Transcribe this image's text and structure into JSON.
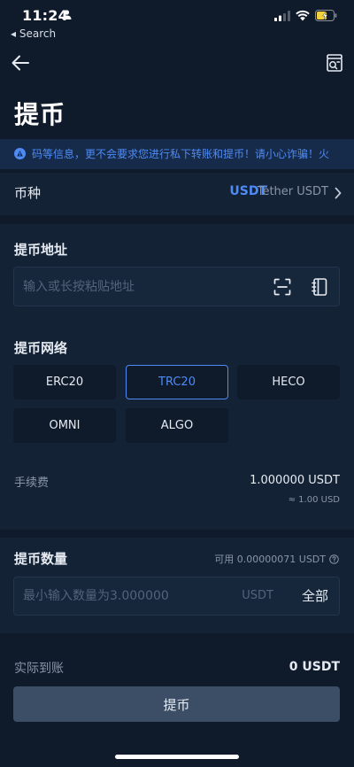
{
  "status_bar": {
    "time": "11:24",
    "back_label": "◂ Search"
  },
  "header": {
    "title": "提币"
  },
  "notice": {
    "text": "码等信息，更不会要求您进行私下转账和提币！请小心诈骗！火"
  },
  "coin": {
    "label": "币种",
    "symbol": "USDT",
    "name": "Tether USDT"
  },
  "address": {
    "label": "提币地址",
    "placeholder": "输入或长按粘贴地址"
  },
  "network": {
    "label": "提币网络",
    "options": [
      "ERC20",
      "TRC20",
      "HECO",
      "OMNI",
      "ALGO"
    ],
    "selected": "TRC20"
  },
  "fee": {
    "label": "手续费",
    "value": "1.000000 USDT",
    "fiat": "≈ 1.00 USD"
  },
  "amount": {
    "label": "提币数量",
    "available": "可用 0.00000071 USDT",
    "placeholder": "最小输入数量为3.000000",
    "unit": "USDT",
    "all_label": "全部"
  },
  "received": {
    "label": "实际到账",
    "value": "0 USDT"
  },
  "submit": {
    "label": "提币"
  },
  "colors": {
    "accent": "#4f8bf5",
    "background": "#0f1a2b",
    "card": "#142235"
  }
}
